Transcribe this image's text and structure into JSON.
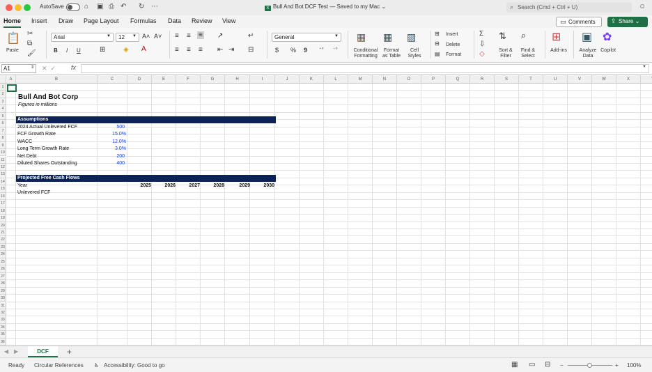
{
  "titlebar": {
    "autosave_label": "AutoSave",
    "doc_title": "Bull And Bot DCF Test — Saved to my Mac",
    "search_placeholder": "Search (Cmd + Ctrl + U)"
  },
  "menu_tabs": [
    "Home",
    "Insert",
    "Draw",
    "Page Layout",
    "Formulas",
    "Data",
    "Review",
    "View"
  ],
  "active_tab": "Home",
  "actions": {
    "comments": "Comments",
    "share": "Share"
  },
  "ribbon": {
    "paste": "Paste",
    "font_name": "Arial",
    "font_size": "12",
    "number_format": "General",
    "conditional_formatting": "Conditional\nFormatting",
    "format_as_table": "Format\nas Table",
    "cell_styles": "Cell\nStyles",
    "insert": "Insert",
    "delete": "Delete",
    "format": "Format",
    "sort_filter": "Sort &\nFilter",
    "find_select": "Find &\nSelect",
    "add_ins": "Add-ins",
    "analyze_data": "Analyze\nData",
    "copilot": "Copilot",
    "bold": "B",
    "italic": "I",
    "underline": "U",
    "currency": "$",
    "percent": "%",
    "comma": "9"
  },
  "formula_bar": {
    "name_box": "A1",
    "fx": "fx",
    "value": ""
  },
  "columns": [
    "A",
    "B",
    "C",
    "D",
    "E",
    "F",
    "G",
    "H",
    "I",
    "J",
    "K",
    "L",
    "M",
    "N",
    "O",
    "P",
    "Q",
    "R",
    "S",
    "T",
    "U",
    "V",
    "W",
    "X",
    "Y"
  ],
  "rows": [
    "1",
    "2",
    "3",
    "4",
    "5",
    "6",
    "7",
    "8",
    "9",
    "10",
    "11",
    "12",
    "13",
    "14",
    "15",
    "16",
    "17",
    "18",
    "19",
    "20",
    "21",
    "22",
    "23",
    "24",
    "25",
    "26",
    "27",
    "28",
    "29",
    "30",
    "31",
    "32",
    "33",
    "34",
    "35",
    "36"
  ],
  "sheet": {
    "company": "Bull And Bot Corp",
    "subtitle": "Figures in millions",
    "assumptions_header": "Assumptions",
    "assumptions": [
      {
        "label": "2024 Actual Unlevered FCF",
        "value": "500"
      },
      {
        "label": "FCF Growth Rate",
        "value": "15.0%"
      },
      {
        "label": "WACC",
        "value": "12.0%"
      },
      {
        "label": "Long Term Growth Rate",
        "value": "3.0%"
      },
      {
        "label": "Net Debt",
        "value": "200"
      },
      {
        "label": "Diluted Shares Outstanding",
        "value": "400"
      }
    ],
    "projection_header": "Projected Free Cash Flows",
    "year_label": "Year",
    "years": [
      "2025",
      "2026",
      "2027",
      "2028",
      "2029",
      "2030"
    ],
    "fcf_label": "Unlevered FCF"
  },
  "sheet_tabs": [
    "DCF"
  ],
  "status": {
    "ready": "Ready",
    "circular": "Circular References",
    "accessibility": "Accessibility: Good to go",
    "zoom": "100%"
  },
  "colors": {
    "accent": "#1e7145",
    "header_band": "#0d2357",
    "input_blue": "#0a3cf0"
  }
}
